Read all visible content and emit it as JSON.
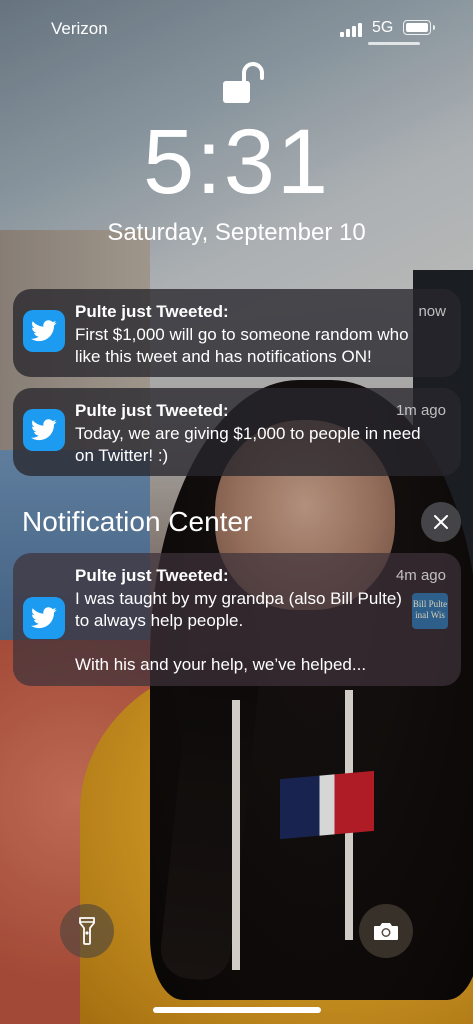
{
  "status_bar": {
    "carrier": "Verizon",
    "network": "5G",
    "signal_bars": 4,
    "battery_level": 0.9
  },
  "lock_screen": {
    "time": "5:31",
    "date": "Saturday, September 10",
    "lock_icon": "unlocked-padlock-icon"
  },
  "notifications": [
    {
      "app_icon": "twitter-bird-icon",
      "title": "Pulte just Tweeted:",
      "age": "now",
      "body": "First $1,000 will go to someone random who like this tweet and has notifications ON!"
    },
    {
      "app_icon": "twitter-bird-icon",
      "title": "Pulte just Tweeted:",
      "age": "1m ago",
      "body": "Today, we are giving $1,000 to people in need on Twitter! :)"
    }
  ],
  "notification_center": {
    "title": "Notification Center",
    "close_icon": "close-x-icon",
    "items": [
      {
        "app_icon": "twitter-bird-icon",
        "title": "Pulte just Tweeted:",
        "age": "4m ago",
        "body_line1": "I was taught by my grandpa (also Bill Pulte) to always help people.",
        "body_line2": "With his and your help, we’ve helped...",
        "thumbnail_text": "Bill Pulte inal Wis"
      }
    ]
  },
  "quick_actions": {
    "flashlight_icon": "flashlight-icon",
    "camera_icon": "camera-icon"
  },
  "colors": {
    "twitter_blue": "#1d9bf0"
  }
}
